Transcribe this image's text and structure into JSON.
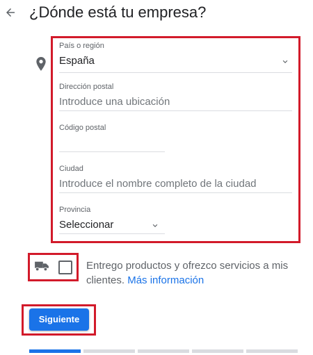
{
  "header": {
    "title": "¿Dónde está tu empresa?",
    "back_icon": "arrow-left-icon"
  },
  "form": {
    "location_icon": "map-pin-icon",
    "country": {
      "label": "País o región",
      "value": "España",
      "icon": "chevron-down-icon"
    },
    "address": {
      "label": "Dirección postal",
      "placeholder": "Introduce una ubicación"
    },
    "postal_code": {
      "label": "Código postal",
      "value": ""
    },
    "city": {
      "label": "Ciudad",
      "placeholder": "Introduce el nombre completo de la ciudad"
    },
    "province": {
      "label": "Provincia",
      "value": "Seleccionar",
      "icon": "chevron-down-icon"
    }
  },
  "delivery": {
    "icon": "truck-icon",
    "text": "Entrego productos y ofrezco servicios a mis clientes.",
    "link": "Más información",
    "checked": false
  },
  "actions": {
    "next_label": "Siguiente"
  },
  "progress": {
    "total_steps": 5,
    "current_step": 1
  },
  "colors": {
    "accent": "#1a73e8",
    "highlight_border": "#d21a2a",
    "progress_inactive": "#dadce0"
  }
}
